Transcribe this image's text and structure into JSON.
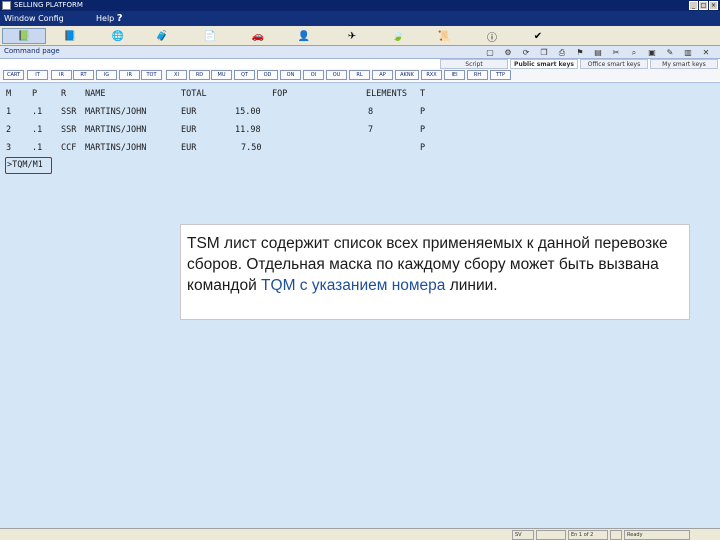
{
  "window": {
    "title": "SELLING PLATFORM"
  },
  "menu": {
    "window_label": "Window Config",
    "help_label": "Help"
  },
  "toolbar": {
    "icons": [
      "book-icon",
      "green-book-icon",
      "globe-icon",
      "bag-icon",
      "document-icon",
      "car-icon",
      "person-icon",
      "plane-icon",
      "leaf-icon",
      "scroll-icon",
      "info-icon",
      "check-icon"
    ]
  },
  "command_page": {
    "label": "Command page",
    "subtabs": [
      "Script",
      "Public smart keys",
      "Office smart keys",
      "My smart keys"
    ],
    "active_subtab": 1,
    "commands": [
      "CART",
      "IT",
      "IR",
      "RT",
      "IG",
      "IR",
      "TOT",
      "XI",
      "RD",
      "MU",
      "QT",
      "OD",
      "ON",
      "OI",
      "OU",
      "RL",
      "AP",
      "AKNK",
      "RXX",
      "IEI",
      "RH",
      "TTP"
    ]
  },
  "screen": {
    "headers": [
      "M",
      "P",
      "R",
      "NAME",
      "TOTAL",
      "FOP",
      "ELEMENTS",
      "T"
    ],
    "rows": [
      {
        "m": "1",
        "p": ".1",
        "r": "SSR",
        "name": "MARTINS/JOHN",
        "cur": "EUR",
        "total": "15.00",
        "elements": "8",
        "t": "P"
      },
      {
        "m": "2",
        "p": ".1",
        "r": "SSR",
        "name": "MARTINS/JOHN",
        "cur": "EUR",
        "total": "11.98",
        "elements": "7",
        "t": "P"
      },
      {
        "m": "3",
        "p": ".1",
        "r": "CCF",
        "name": "MARTINS/JOHN",
        "cur": "EUR",
        "total": "7.50",
        "elements": "",
        "t": "P"
      }
    ],
    "prompt": ">TQM/M1"
  },
  "callout": {
    "part1": "TSM лист содержит список всех применяемых к данной перевозке сборов. Отдельная маска по каждому сбору может быть вызвана командой ",
    "highlight": "TQM с указанием номера",
    "part2": " линии.",
    "prefix": "TSM",
    "accent": "#1e4f9b"
  },
  "status": {
    "cell1": "SV",
    "cell2": "En 1 of 2",
    "cell3": "Ready"
  }
}
